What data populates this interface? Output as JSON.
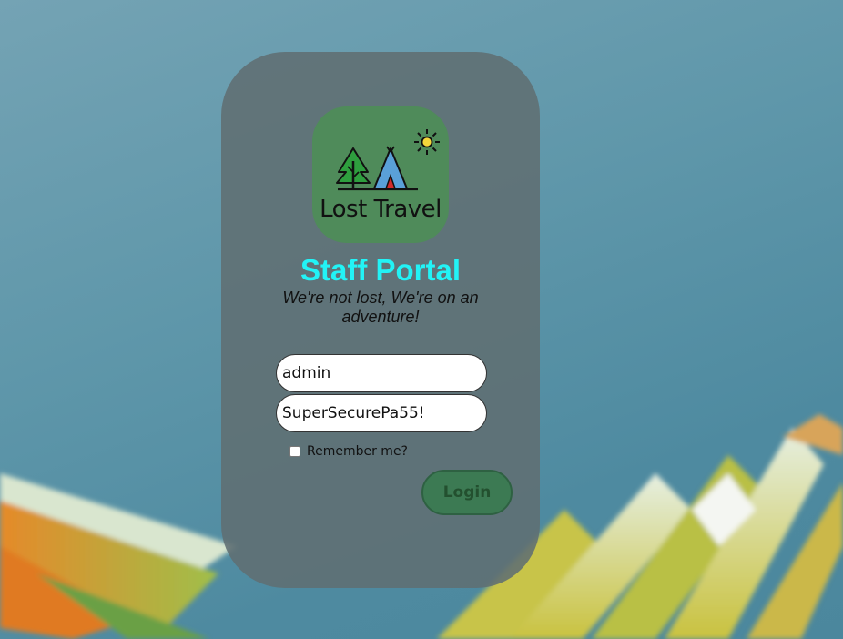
{
  "logo": {
    "text": "Lost Travel",
    "icons": [
      "tree-icon",
      "tent-icon",
      "sun-icon"
    ]
  },
  "header": {
    "title": "Staff Portal",
    "tagline": "We're not lost, We're on an adventure!"
  },
  "form": {
    "username_value": "admin",
    "password_value": "SuperSecurePa55!",
    "remember_label": "Remember me?",
    "remember_checked": false,
    "login_label": "Login"
  },
  "colors": {
    "title": "#22f3f6",
    "logo_background": "#4f8b5a",
    "login_button": "#3c7a53",
    "card": "#606e72"
  }
}
